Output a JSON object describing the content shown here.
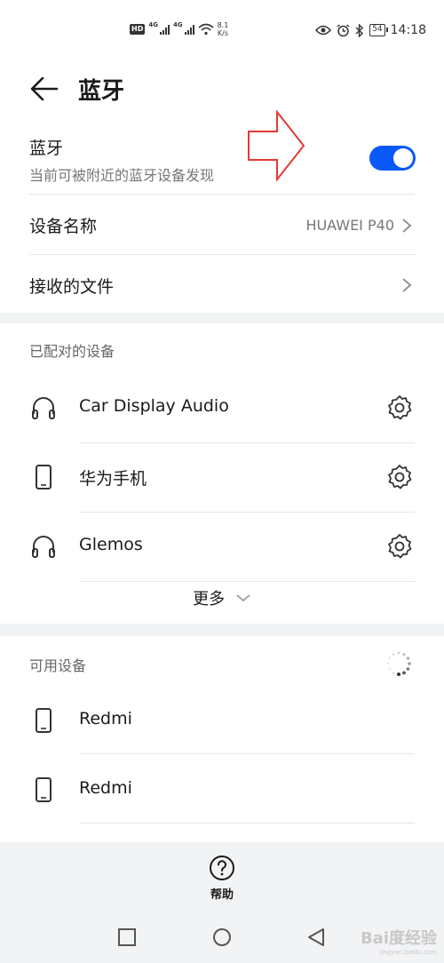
{
  "status_bar": {
    "hd": "HD",
    "net_left": "4G",
    "net_right": "4G",
    "speed_value": "8.1",
    "speed_unit": "K/s",
    "battery": "54",
    "time": "14:18",
    "icons": [
      "eye-icon",
      "alarm-icon",
      "bluetooth-icon"
    ]
  },
  "header": {
    "title": "蓝牙"
  },
  "bluetooth": {
    "title": "蓝牙",
    "subtitle": "当前可被附近的蓝牙设备发现",
    "enabled": true,
    "accent": "#0a59f7",
    "annotation_color": "#e53935"
  },
  "device_name": {
    "label": "设备名称",
    "value": "HUAWEI P40"
  },
  "received_files": {
    "label": "接收的文件"
  },
  "paired": {
    "title": "已配对的设备",
    "devices": [
      {
        "name": "Car Display Audio",
        "icon": "headphones-icon"
      },
      {
        "name": "华为手机",
        "icon": "phone-icon"
      },
      {
        "name": "Glemos",
        "icon": "headphones-icon"
      }
    ],
    "more_label": "更多"
  },
  "available": {
    "title": "可用设备",
    "devices": [
      {
        "name": "Redmi",
        "icon": "phone-icon"
      },
      {
        "name": "Redmi",
        "icon": "phone-icon"
      }
    ]
  },
  "bottom": {
    "help_label": "帮助"
  },
  "watermark": {
    "main": "Bai度经验",
    "sub": "jingyan.baidu.com"
  }
}
